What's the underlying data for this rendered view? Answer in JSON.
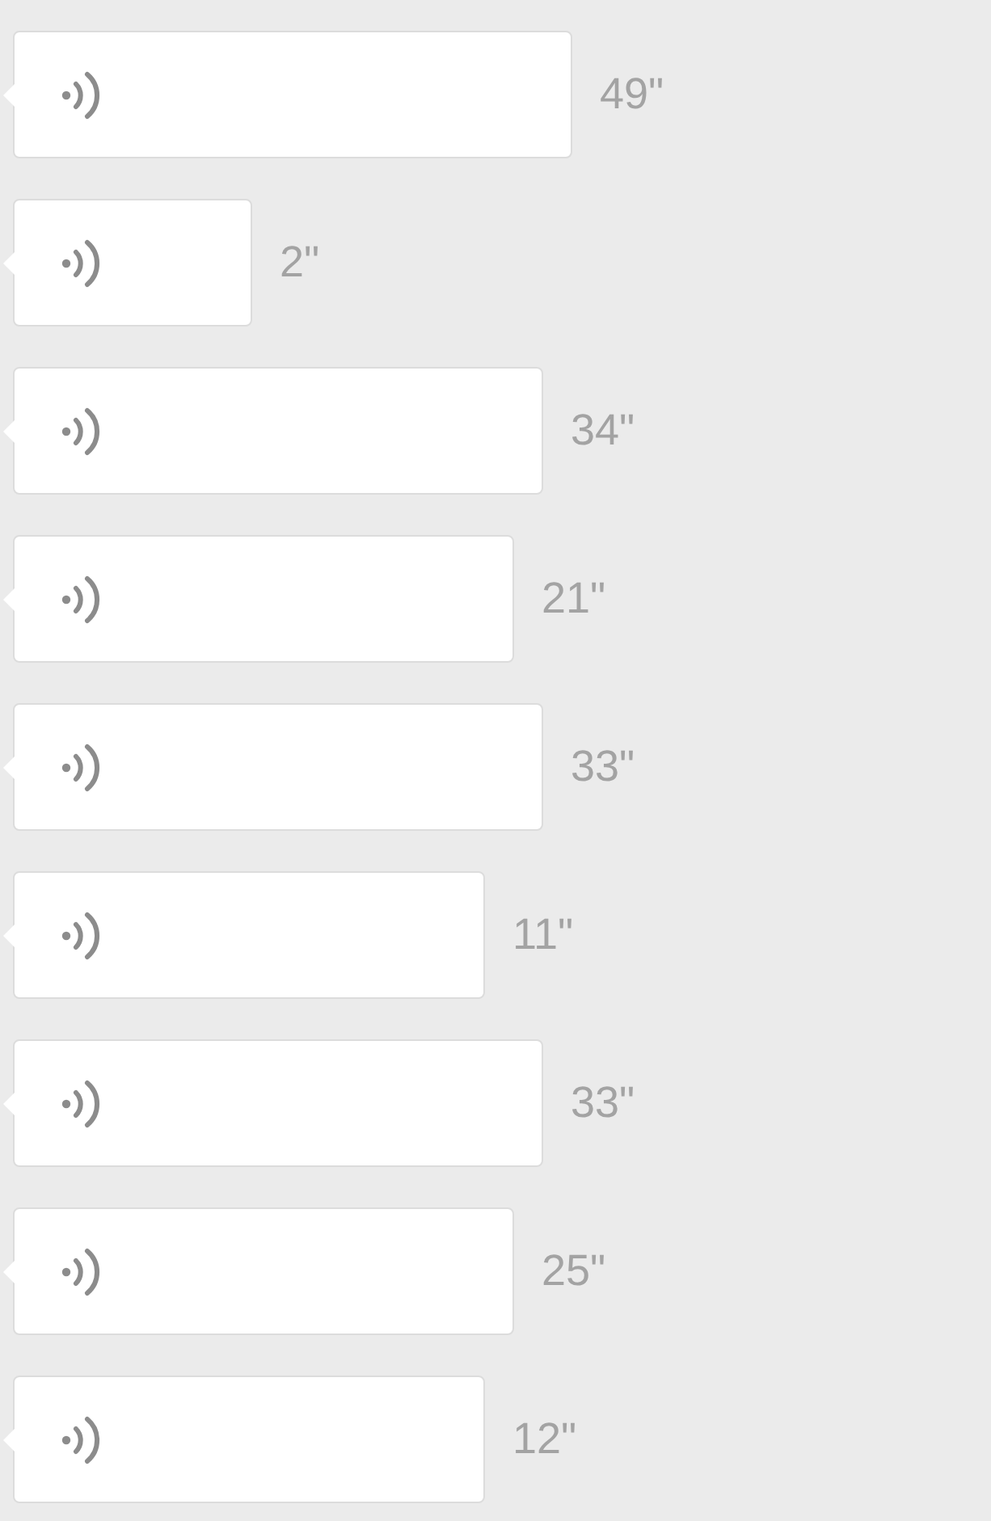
{
  "voice_messages": [
    {
      "duration": "49\""
    },
    {
      "duration": "2\""
    },
    {
      "duration": "34\""
    },
    {
      "duration": "21\""
    },
    {
      "duration": "33\""
    },
    {
      "duration": "11\""
    },
    {
      "duration": "33\""
    },
    {
      "duration": "25\""
    },
    {
      "duration": "12\""
    }
  ]
}
